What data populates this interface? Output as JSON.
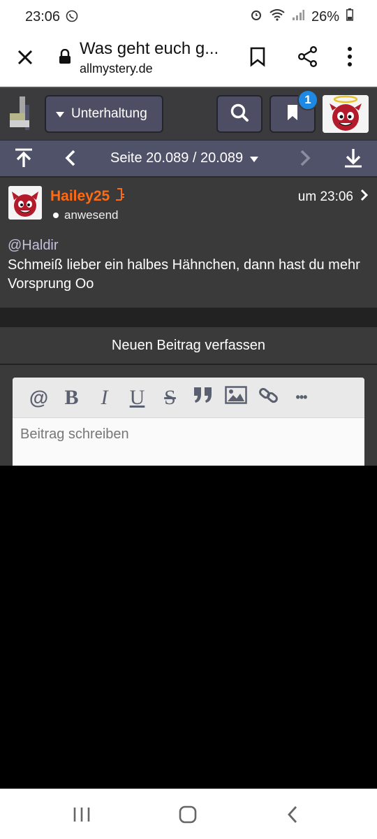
{
  "statusbar": {
    "time": "23:06",
    "battery": "26%"
  },
  "browser": {
    "title": "Was geht euch g...",
    "url": "allmystery.de"
  },
  "header": {
    "category_label": "Unterhaltung",
    "bookmark_badge": "1"
  },
  "pager": {
    "label": "Seite 20.089 / 20.089"
  },
  "post": {
    "username": "Hailey25",
    "status": "anwesend",
    "time": "um 23:06",
    "mention": "@Haldir",
    "body": "Schmeiß lieber ein halbes Hähnchen, dann hast du mehr Vorsprung Oo"
  },
  "compose": {
    "heading": "Neuen Beitrag verfassen",
    "toolbar": {
      "mention": "@",
      "bold": "B",
      "italic": "I",
      "underline": "U",
      "strike": "S",
      "quote": "❞",
      "more": "•••"
    },
    "placeholder": "Beitrag schreiben"
  },
  "colors": {
    "username": "#ff6a12",
    "badge": "#1e88e5",
    "header_bg": "#3b3b3d",
    "pager_bg": "#50526a"
  }
}
